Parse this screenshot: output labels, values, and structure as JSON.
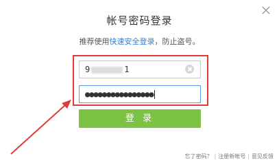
{
  "title": "帐号密码登录",
  "subtitle": {
    "prefix": "推荐使用",
    "link": "快速安全登录",
    "suffix": "，防止盗号。"
  },
  "username": {
    "visible_start": "9",
    "visible_end": "1"
  },
  "password": {
    "masked_value": "●●●●●●●●●●●●●●●●"
  },
  "login_button": "登 录",
  "footer": {
    "forgot_password": "忘了密码？",
    "separator": "|",
    "register": "注册新帐号",
    "feedback": "意见反馈"
  },
  "colors": {
    "primary_button": "#7cc243",
    "link": "#2f7fd8",
    "annotation": "#e03a3a"
  }
}
